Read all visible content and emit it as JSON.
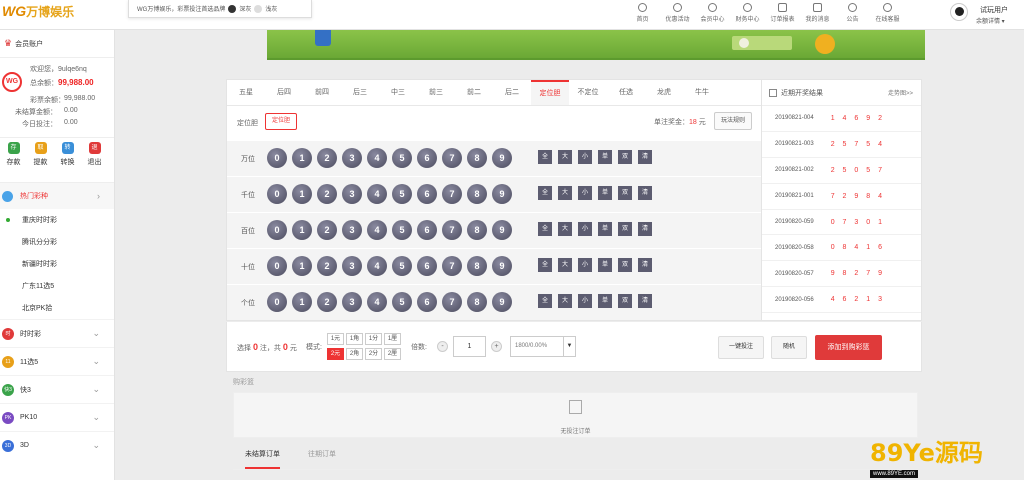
{
  "header": {
    "logo_latin": "WG",
    "logo_cn": "万博娱乐",
    "theme_text": "WG万博娱乐，彩票投注首选品牌",
    "theme_dark": "深灰",
    "theme_light": "浅灰",
    "nav": [
      "首页",
      "优惠活动",
      "会员中心",
      "财务中心",
      "订单报表",
      "我的消息",
      "公告",
      "在线客服"
    ],
    "user_name": "试玩用户",
    "user_sub": "余额详情 ▾"
  },
  "sidebar": {
    "title": "会员账户",
    "logo": "WG",
    "welcome": "欢迎您，9ulqe6nq",
    "total_label": "总余额：",
    "total_value": "99,988.00",
    "lottery_label": "彩票余额：",
    "lottery_value": "99,988.00",
    "unsettled_label": "未结算金额：",
    "unsettled_value": "0.00",
    "today_label": "今日投注：",
    "today_value": "0.00",
    "quick": [
      {
        "label": "存款",
        "icon": "存",
        "color": "#3aa34a"
      },
      {
        "label": "提款",
        "icon": "取",
        "color": "#e8a019"
      },
      {
        "label": "转换",
        "icon": "转",
        "color": "#3a8fd8"
      },
      {
        "label": "退出",
        "icon": "退",
        "color": "#e03a3a"
      }
    ],
    "hot": "热门彩种",
    "sub_items": [
      "重庆时时彩",
      "腾讯分分彩",
      "新疆时时彩",
      "广东11选5",
      "北京PK拾"
    ],
    "categories": [
      {
        "label": "时时彩",
        "color": "#e03a3a",
        "icon": "时"
      },
      {
        "label": "11选5",
        "color": "#e8a019",
        "icon": "11"
      },
      {
        "label": "快3",
        "color": "#3aa34a",
        "icon": "快3"
      },
      {
        "label": "PK10",
        "color": "#7a4bc2",
        "icon": "PK"
      },
      {
        "label": "3D",
        "color": "#3a6fd8",
        "icon": "3D"
      }
    ]
  },
  "game": {
    "tabs": [
      "五星",
      "后四",
      "前四",
      "后三",
      "中三",
      "前三",
      "前二",
      "后二",
      "定位胆",
      "不定位",
      "任选",
      "龙虎",
      "牛牛"
    ],
    "active_tab": "定位胆",
    "play_label": "定位胆",
    "play_button": "定位胆",
    "prize_label": "单注奖金：",
    "prize_value": "18",
    "prize_unit": "元",
    "rules": "玩法规则",
    "positions": [
      "万位",
      "千位",
      "百位",
      "十位",
      "个位"
    ],
    "digits": [
      "0",
      "1",
      "2",
      "3",
      "4",
      "5",
      "6",
      "7",
      "8",
      "9"
    ],
    "quick_select": [
      "全",
      "大",
      "小",
      "单",
      "双",
      "清"
    ]
  },
  "results": {
    "title": "近期开奖结果",
    "trend": "走势图>>",
    "rows": [
      {
        "issue": "20190821-004",
        "nums": "1 4 6 9 2"
      },
      {
        "issue": "20190821-003",
        "nums": "2 5 7 5 4"
      },
      {
        "issue": "20190821-002",
        "nums": "2 5 0 5 7"
      },
      {
        "issue": "20190821-001",
        "nums": "7 2 9 8 4"
      },
      {
        "issue": "20190820-059",
        "nums": "0 7 3 0 1"
      },
      {
        "issue": "20190820-058",
        "nums": "0 8 4 1 6"
      },
      {
        "issue": "20190820-057",
        "nums": "9 8 2 7 9"
      },
      {
        "issue": "20190820-056",
        "nums": "4 6 2 1 3"
      }
    ]
  },
  "betbar": {
    "selected_prefix": "选择",
    "selected_count": "0",
    "count_unit": "注，共",
    "amount": "0",
    "amount_unit": "元",
    "mode_label": "模式:",
    "modes": [
      "1元",
      "1角",
      "1分",
      "1厘",
      "2元",
      "2角",
      "2分",
      "2厘"
    ],
    "active_mode": "2元",
    "multiplier_label": "倍数:",
    "minus": "-",
    "multiplier": "1",
    "plus": "+",
    "rate": "1800/0.00%",
    "one_click": "一键投注",
    "random": "随机",
    "add_cart": "添加到购彩篮"
  },
  "cart": {
    "title": "购彩篮",
    "empty": "无投注订单",
    "order_tabs": [
      "未结算订单",
      "往期订单"
    ]
  },
  "watermark": {
    "big": "89Ye源码",
    "small": "www.89YE.com"
  }
}
